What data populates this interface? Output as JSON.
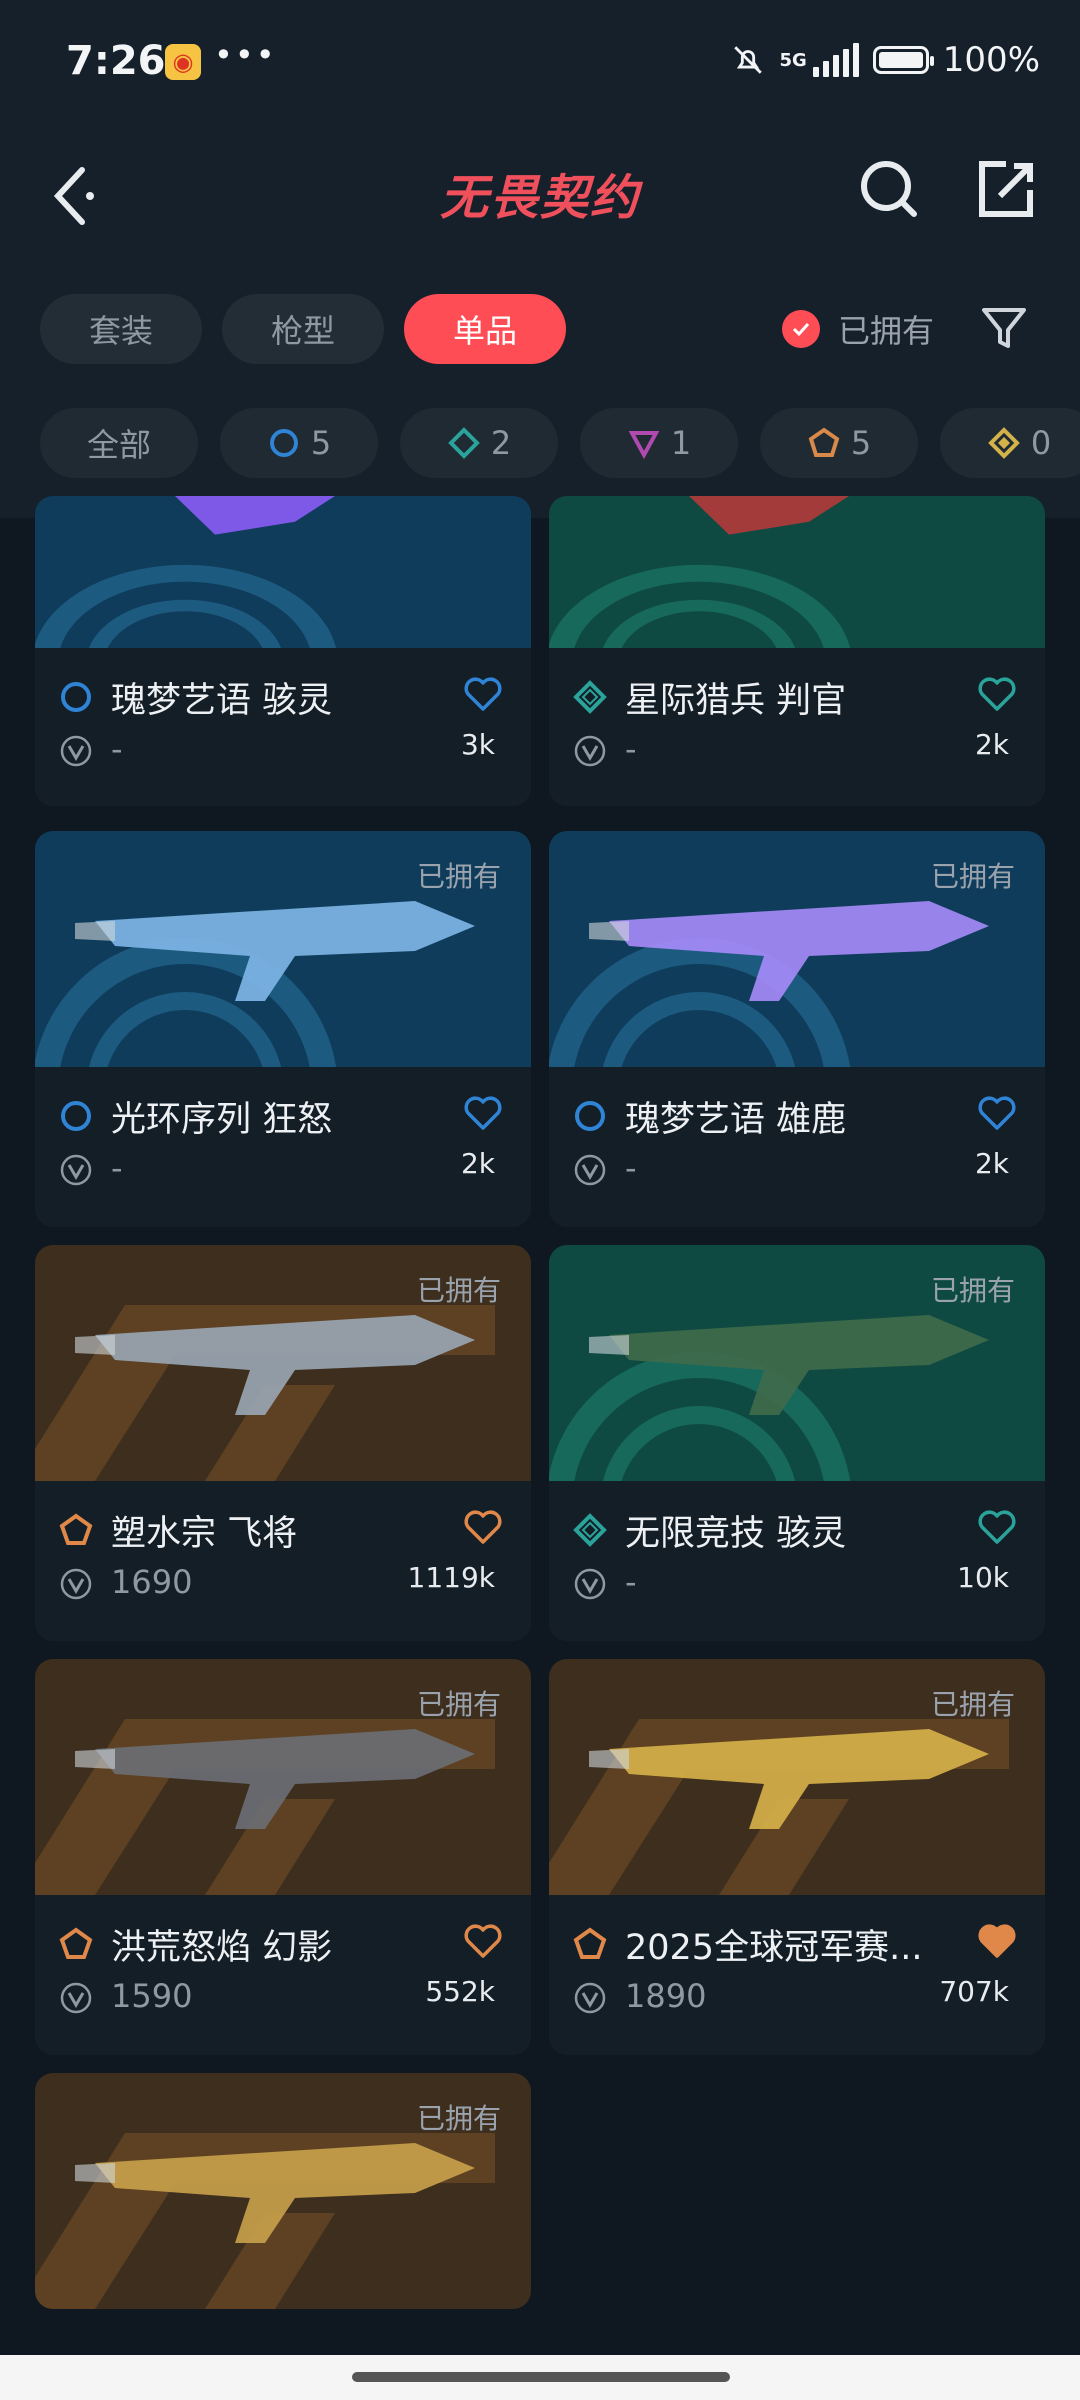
{
  "status_bar": {
    "time": "7:26",
    "network": "5G",
    "battery": "100%"
  },
  "header": {
    "title": "无畏契约"
  },
  "tabs": [
    {
      "label": "套装",
      "active": false
    },
    {
      "label": "枪型",
      "active": false
    },
    {
      "label": "单品",
      "active": true
    }
  ],
  "owned_filter": {
    "label": "已拥有",
    "checked": true
  },
  "chips": [
    {
      "label": "全部",
      "icon": "all"
    },
    {
      "label": "5",
      "icon": "tier-select-icon",
      "color": "#2f84d6"
    },
    {
      "label": "2",
      "icon": "tier-deluxe-icon",
      "color": "#2aa39a"
    },
    {
      "label": "1",
      "icon": "tier-premium-icon",
      "color": "#b04ab0"
    },
    {
      "label": "5",
      "icon": "tier-exclusive-icon",
      "color": "#d98a4a"
    },
    {
      "label": "0",
      "icon": "tier-ultra-icon",
      "color": "#d4b24a"
    }
  ],
  "cards": [
    {
      "name": "瑰梦艺语 骇灵",
      "price": "-",
      "likes": "3k",
      "owned": "",
      "tier": "select",
      "heart_filled": false,
      "bg": "blue"
    },
    {
      "name": "星际猎兵 判官",
      "price": "-",
      "likes": "2k",
      "owned": "",
      "tier": "deluxe",
      "heart_filled": false,
      "bg": "green"
    },
    {
      "name": "光环序列 狂怒",
      "price": "-",
      "likes": "2k",
      "owned": "已拥有",
      "tier": "select",
      "heart_filled": false,
      "bg": "blue"
    },
    {
      "name": "瑰梦艺语 雄鹿",
      "price": "-",
      "likes": "2k",
      "owned": "已拥有",
      "tier": "select",
      "heart_filled": false,
      "bg": "blue"
    },
    {
      "name": "塑水宗 飞将",
      "price": "1690",
      "likes": "1119k",
      "owned": "已拥有",
      "tier": "exclusive",
      "heart_filled": false,
      "bg": "orange"
    },
    {
      "name": "无限竞技 骇灵",
      "price": "-",
      "likes": "10k",
      "owned": "已拥有",
      "tier": "deluxe",
      "heart_filled": false,
      "bg": "green"
    },
    {
      "name": "洪荒怒焰 幻影",
      "price": "1590",
      "likes": "552k",
      "owned": "已拥有",
      "tier": "exclusive",
      "heart_filled": false,
      "bg": "orange"
    },
    {
      "name": "2025全球冠军赛...",
      "price": "1890",
      "likes": "707k",
      "owned": "已拥有",
      "tier": "exclusive",
      "heart_filled": true,
      "bg": "orange"
    },
    {
      "name": "",
      "price": "",
      "likes": "",
      "owned": "已拥有",
      "tier": "exclusive",
      "heart_filled": false,
      "bg": "orange"
    }
  ],
  "colors": {
    "accent": "#ff4d55",
    "select": "#2f84d6",
    "deluxe": "#2aa39a",
    "exclusive": "#e0884a"
  }
}
